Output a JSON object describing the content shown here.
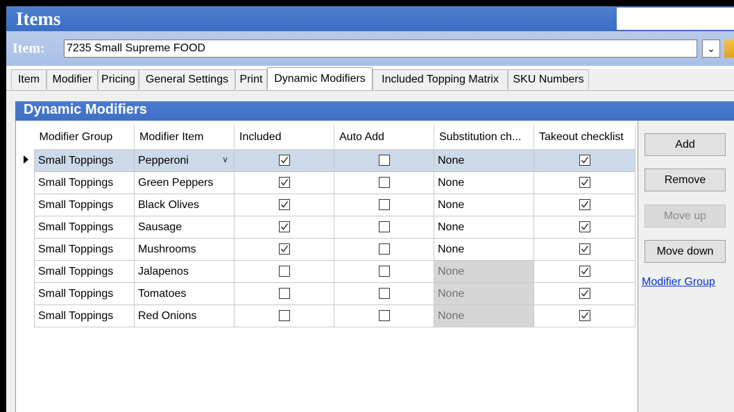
{
  "window": {
    "title": "Items"
  },
  "item_bar": {
    "label": "Item:",
    "selected_item": "7235 Small Supreme FOOD"
  },
  "tabs": [
    {
      "label": "Item",
      "active": false
    },
    {
      "label": "Modifier",
      "active": false
    },
    {
      "label": "Pricing",
      "active": false
    },
    {
      "label": "General Settings",
      "active": false
    },
    {
      "label": "Print",
      "active": false
    },
    {
      "label": "Dynamic Modifiers",
      "active": true
    },
    {
      "label": "Included Topping Matrix",
      "active": false
    },
    {
      "label": "SKU Numbers",
      "active": false
    }
  ],
  "section": {
    "title": "Dynamic Modifiers"
  },
  "grid": {
    "columns": [
      "Modifier Group",
      "Modifier Item",
      "Included",
      "Auto Add",
      "Substitution ch...",
      "Takeout checklist"
    ],
    "rows": [
      {
        "group": "Small Toppings",
        "item": "Pepperoni",
        "included": true,
        "auto_add": false,
        "substitution": "None",
        "substitution_enabled": true,
        "takeout": true,
        "selected": true
      },
      {
        "group": "Small Toppings",
        "item": "Green Peppers",
        "included": true,
        "auto_add": false,
        "substitution": "None",
        "substitution_enabled": true,
        "takeout": true,
        "selected": false
      },
      {
        "group": "Small Toppings",
        "item": "Black Olives",
        "included": true,
        "auto_add": false,
        "substitution": "None",
        "substitution_enabled": true,
        "takeout": true,
        "selected": false
      },
      {
        "group": "Small Toppings",
        "item": "Sausage",
        "included": true,
        "auto_add": false,
        "substitution": "None",
        "substitution_enabled": true,
        "takeout": true,
        "selected": false
      },
      {
        "group": "Small Toppings",
        "item": "Mushrooms",
        "included": true,
        "auto_add": false,
        "substitution": "None",
        "substitution_enabled": true,
        "takeout": true,
        "selected": false
      },
      {
        "group": "Small Toppings",
        "item": "Jalapenos",
        "included": false,
        "auto_add": false,
        "substitution": "None",
        "substitution_enabled": false,
        "takeout": true,
        "selected": false
      },
      {
        "group": "Small Toppings",
        "item": "Tomatoes",
        "included": false,
        "auto_add": false,
        "substitution": "None",
        "substitution_enabled": false,
        "takeout": true,
        "selected": false
      },
      {
        "group": "Small Toppings",
        "item": "Red Onions",
        "included": false,
        "auto_add": false,
        "substitution": "None",
        "substitution_enabled": false,
        "takeout": true,
        "selected": false
      }
    ]
  },
  "buttons": {
    "add": "Add",
    "remove": "Remove",
    "move_up": "Move up",
    "move_down": "Move down"
  },
  "links": {
    "modifier_group": "Modifier Group"
  }
}
